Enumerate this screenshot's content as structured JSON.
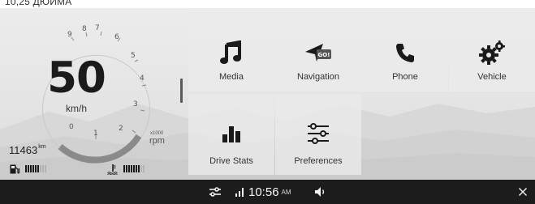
{
  "caption": "10,25 ДЮЙМА",
  "cluster": {
    "speed": "50",
    "speed_unit": "km/h",
    "rpm_ticks": [
      "0",
      "1",
      "2",
      "3",
      "4",
      "5",
      "6",
      "7",
      "8",
      "9"
    ],
    "rpm_multiplier": "x1000",
    "rpm_label": "rpm",
    "rpm_level": 0.22,
    "odometer": "11463",
    "odometer_unit": "km",
    "fuel_level_bars": 6,
    "temp_level_bars": 7,
    "total_bars": 9
  },
  "tiles": [
    {
      "label": "Media",
      "icon": "music-note-icon"
    },
    {
      "label": "Navigation",
      "icon": "navigation-go-icon"
    },
    {
      "label": "Phone",
      "icon": "phone-icon"
    },
    {
      "label": "Vehicle",
      "icon": "gears-icon"
    },
    {
      "label": "Drive Stats",
      "icon": "bar-chart-icon"
    },
    {
      "label": "Preferences",
      "icon": "sliders-icon"
    }
  ],
  "nav_badge": "GO!",
  "statusbar": {
    "time": "10:56",
    "ampm": "AM",
    "icons": [
      "settings-sliders-icon",
      "signal-icon",
      "volume-icon",
      "close-icon"
    ]
  },
  "colors": {
    "statusbar_bg": "#1c1c1c",
    "gauge_arc": "#8a8a8a",
    "bar_on": "#1a1a1a",
    "bar_off": "#b4b4b4"
  }
}
